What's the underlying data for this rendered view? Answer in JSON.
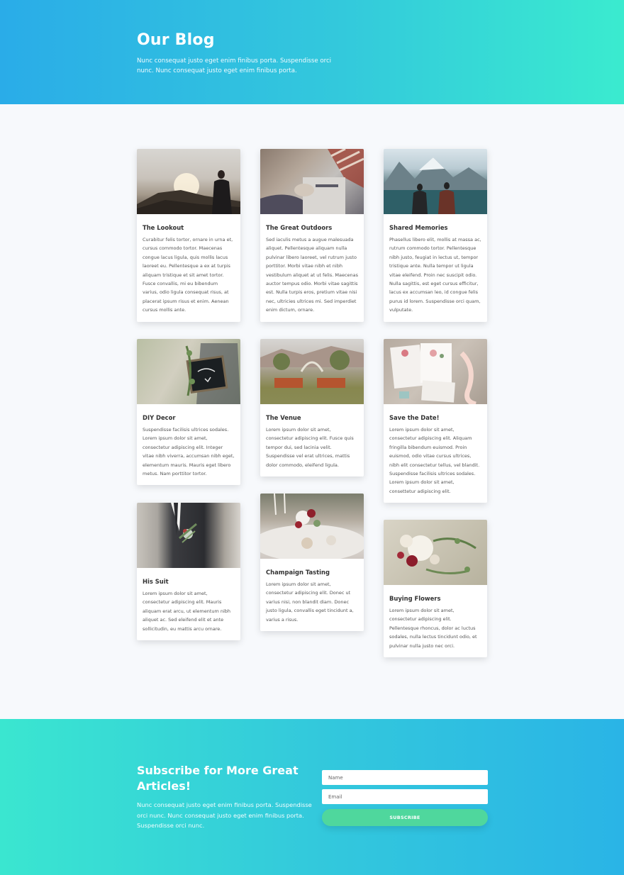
{
  "hero": {
    "title": "Our Blog",
    "subtitle": "Nunc consequat justo eget enim finibus porta. Suspendisse orci nunc. Nunc consequat justo eget enim finibus porta."
  },
  "posts": [
    {
      "title": "The Lookout",
      "text": "Curabitur felis tortor, ornare in urna et, cursus commodo tortor. Maecenas congue lacus ligula, quis mollis lacus laoreet eu. Pellentesque a ex at turpis aliquam tristique et sit amet tortor. Fusce convallis, mi eu bibendum varius, odio ligula consequat risus, at placerat ipsum risus et enim. Aenean cursus mollis ante."
    },
    {
      "title": "The Great Outdoors",
      "text": "Sed iaculis metus a augue malesuada aliquet. Pellentesque aliquam nulla pulvinar libero laoreet, vel rutrum justo porttitor. Morbi vitae nibh et nibh vestibulum aliquet at ut felis. Maecenas auctor tempus odio. Morbi vitae sagittis est. Nulla turpis eros, pretium vitae nisi nec, ultricies ultrices mi. Sed imperdiet enim dictum, ornare."
    },
    {
      "title": "Shared Memories",
      "text": "Phasellus libero elit, mollis at massa ac, rutrum commodo tortor. Pellentesque nibh justo, feugiat in lectus ut, tempor tristique ante. Nulla tempor ut ligula vitae eleifend. Proin nec suscipit odio. Nulla sagittis, est eget cursus efficitur, lacus ex accumsan leo, id congue felis purus id lorem. Suspendisse orci quam, vulputate."
    },
    {
      "title": "DIY Decor",
      "text": "Suspendisse facilisis ultrices sodales. Lorem ipsum dolor sit amet, consectetur adipiscing elit. Integer vitae nibh viverra, accumsan nibh eget, elementum mauris. Mauris eget libero metus. Nam porttitor tortor."
    },
    {
      "title": "The Venue",
      "text": "Lorem ipsum dolor sit amet, consectetur adipiscing elit. Fusce quis tempor dui, sed lacinia velit. Suspendisse vel erat ultrices, mattis dolor commodo, eleifend ligula."
    },
    {
      "title": "Save the Date!",
      "text": "Lorem ipsum dolor sit amet, consectetur adipiscing elit. Aliquam fringilla bibendum euismod. Proin euismod, odio vitae cursus ultrices, nibh elit consectetur tellus, vel blandit. Suspendisse facilisis ultrices sodales. Lorem ipsum dolor sit amet, consettetur adipiscing elit."
    },
    {
      "title": "His Suit",
      "text": "Lorem ipsum dolor sit amet, consectetur adipiscing elit. Mauris aliquam erat arcu, ut elementum nibh aliquet ac. Sed eleifend elit et ante sollicitudin, eu mattis arcu ornare."
    },
    {
      "title": "Champaign Tasting",
      "text": "Lorem ipsum dolor sit amet, consectetur adipiscing elit. Donec ut varius nisi, non blandit diam. Donec justo ligula, convallis eget tincidunt a, varius a risus."
    },
    {
      "title": "Buying Flowers",
      "text": "Lorem ipsum dolor sit amet, consectetur adipiscing elit. Pellentesque rhoncus, dolor ac luctus sodales, nulla lectus tincidunt odio, et pulvinar nulla justo nec orci."
    }
  ],
  "subscribe": {
    "title": "Subscribe for More Great Articles!",
    "text": "Nunc consequat justo eget enim finibus porta. Suspendisse orci nunc. Nunc consequat justo eget enim finibus porta. Suspendisse orci nunc.",
    "name_placeholder": "Name",
    "email_placeholder": "Email",
    "button_label": "SUBSCRIBE"
  }
}
